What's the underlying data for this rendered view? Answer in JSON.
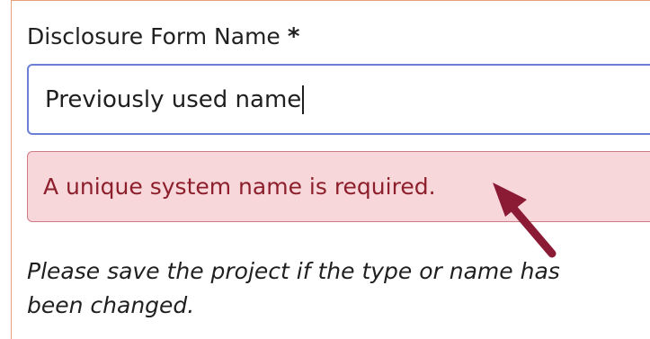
{
  "form": {
    "field_label": "Disclosure Form Name",
    "required_marker": "*",
    "input_value": "Previously used name",
    "error_message": "A unique system name is required.",
    "help_note": "Please save the project if the type or name has been changed."
  },
  "colors": {
    "panel_border": "#e7a07a",
    "input_border": "#6b7fd6",
    "error_background": "#f8d7da",
    "error_border": "#cf7b83",
    "error_text": "#8c1f2b",
    "annotation_arrow": "#8b1a35"
  },
  "icons": {
    "annotation": "arrow-pointing-up-left-icon"
  }
}
